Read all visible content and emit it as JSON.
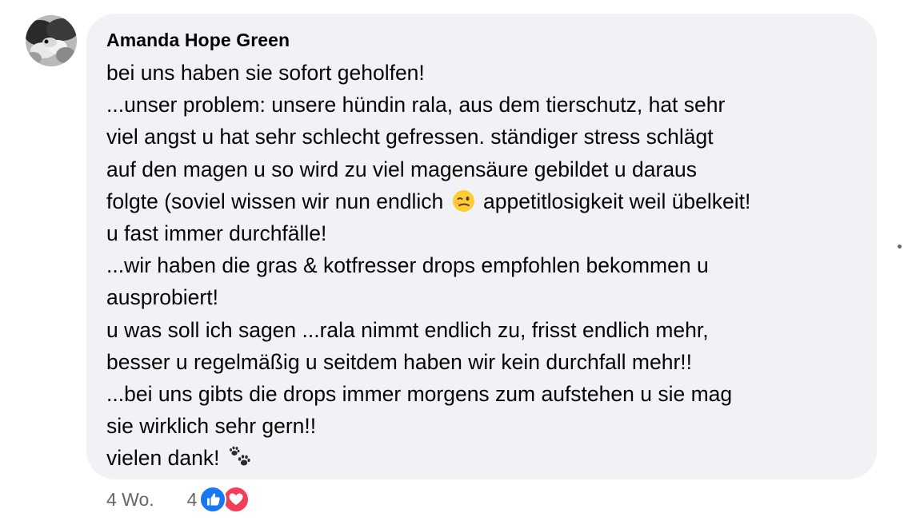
{
  "comment": {
    "author": "Amanda Hope Green",
    "lines": [
      {
        "text": "bei uns haben sie sofort geholfen!"
      },
      {
        "text": "...unser problem: unsere hündin rala, aus dem tierschutz, hat sehr"
      },
      {
        "text": "viel angst u hat sehr schlecht gefressen. ständiger stress schlägt"
      },
      {
        "text": "auf den magen u so wird zu viel magensäure gebildet u daraus"
      },
      {
        "before": "folgte (soviel wissen wir nun endlich",
        "emoji": "winking-face-emoji",
        "after": "appetitlosigkeit weil übelkeit!"
      },
      {
        "text": "u fast immer durchfälle!"
      },
      {
        "text": "...wir haben die gras & kotfresser drops empfohlen bekommen u"
      },
      {
        "text": "ausprobiert!"
      },
      {
        "text": "u was soll ich sagen ...rala nimmt endlich zu, frisst endlich mehr,"
      },
      {
        "text": "besser u regelmäßig u seitdem haben wir kein durchfall mehr!!"
      },
      {
        "text": "...bei uns gibts die drops immer morgens zum aufstehen u sie mag"
      },
      {
        "text": "sie wirklich sehr gern!!"
      },
      {
        "before": "vielen dank!",
        "emoji": "paw-prints-emoji",
        "after": ""
      }
    ]
  },
  "footer": {
    "timestamp": "4 Wo.",
    "reaction_count": "4",
    "reaction_icons": [
      "like-icon",
      "love-icon"
    ]
  },
  "colors": {
    "bubble_bg": "#f0f2f5",
    "text": "#050505",
    "secondary_text": "#65676b",
    "like_blue": "#1877f2",
    "love_red": "#f33e58"
  }
}
